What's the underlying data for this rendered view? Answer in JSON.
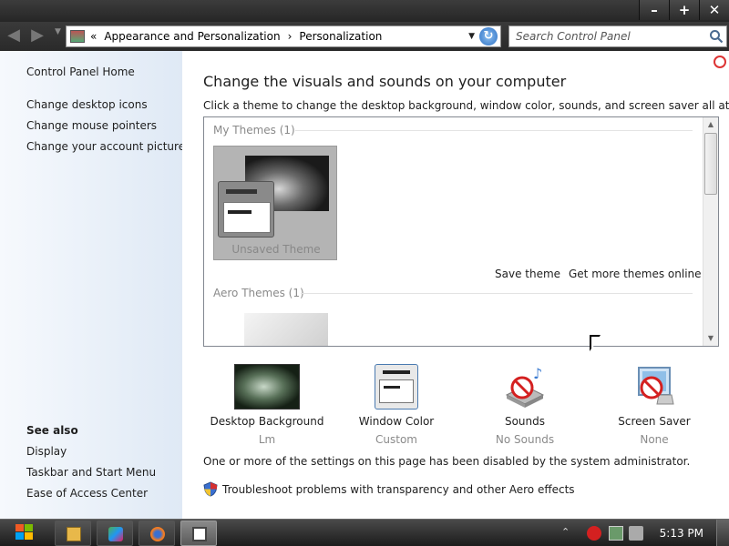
{
  "window": {
    "controls": {
      "minimize": "–",
      "maximize": "+",
      "close": "✕"
    }
  },
  "nav": {
    "back_icon": "back-arrow-icon",
    "forward_icon": "forward-arrow-icon",
    "overflow": "«",
    "breadcrumbs": [
      "Appearance and Personalization",
      "Personalization"
    ],
    "separator": "›",
    "search_placeholder": "Search Control Panel"
  },
  "sidebar": {
    "home": "Control Panel Home",
    "links": [
      "Change desktop icons",
      "Change mouse pointers",
      "Change your account picture"
    ],
    "see_also_title": "See also",
    "see_also": [
      "Display",
      "Taskbar and Start Menu",
      "Ease of Access Center"
    ]
  },
  "main": {
    "heading": "Change the visuals and sounds on your computer",
    "subtext": "Click a theme to change the desktop background, window color, sounds, and screen saver all at once.",
    "my_themes_label": "My Themes (1)",
    "unsaved_theme": "Unsaved Theme",
    "save_theme": "Save theme",
    "get_more_themes": "Get more themes online",
    "aero_themes_label": "Aero Themes (1)",
    "settings": [
      {
        "label": "Desktop Background",
        "value": "Lm"
      },
      {
        "label": "Window Color",
        "value": "Custom"
      },
      {
        "label": "Sounds",
        "value": "No Sounds"
      },
      {
        "label": "Screen Saver",
        "value": "None"
      }
    ],
    "disabled_note": "One or more of the settings on this page has been disabled by the system administrator.",
    "troubleshoot": "Troubleshoot problems with transparency and other Aero effects"
  },
  "taskbar": {
    "clock": "5:13 PM"
  },
  "colors": {
    "sidebar_gradient_start": "#f6f9fd",
    "sidebar_gradient_end": "#dfe9f5",
    "chrome_dark": "#2a2a2a",
    "muted_text": "#8a8a8a"
  }
}
